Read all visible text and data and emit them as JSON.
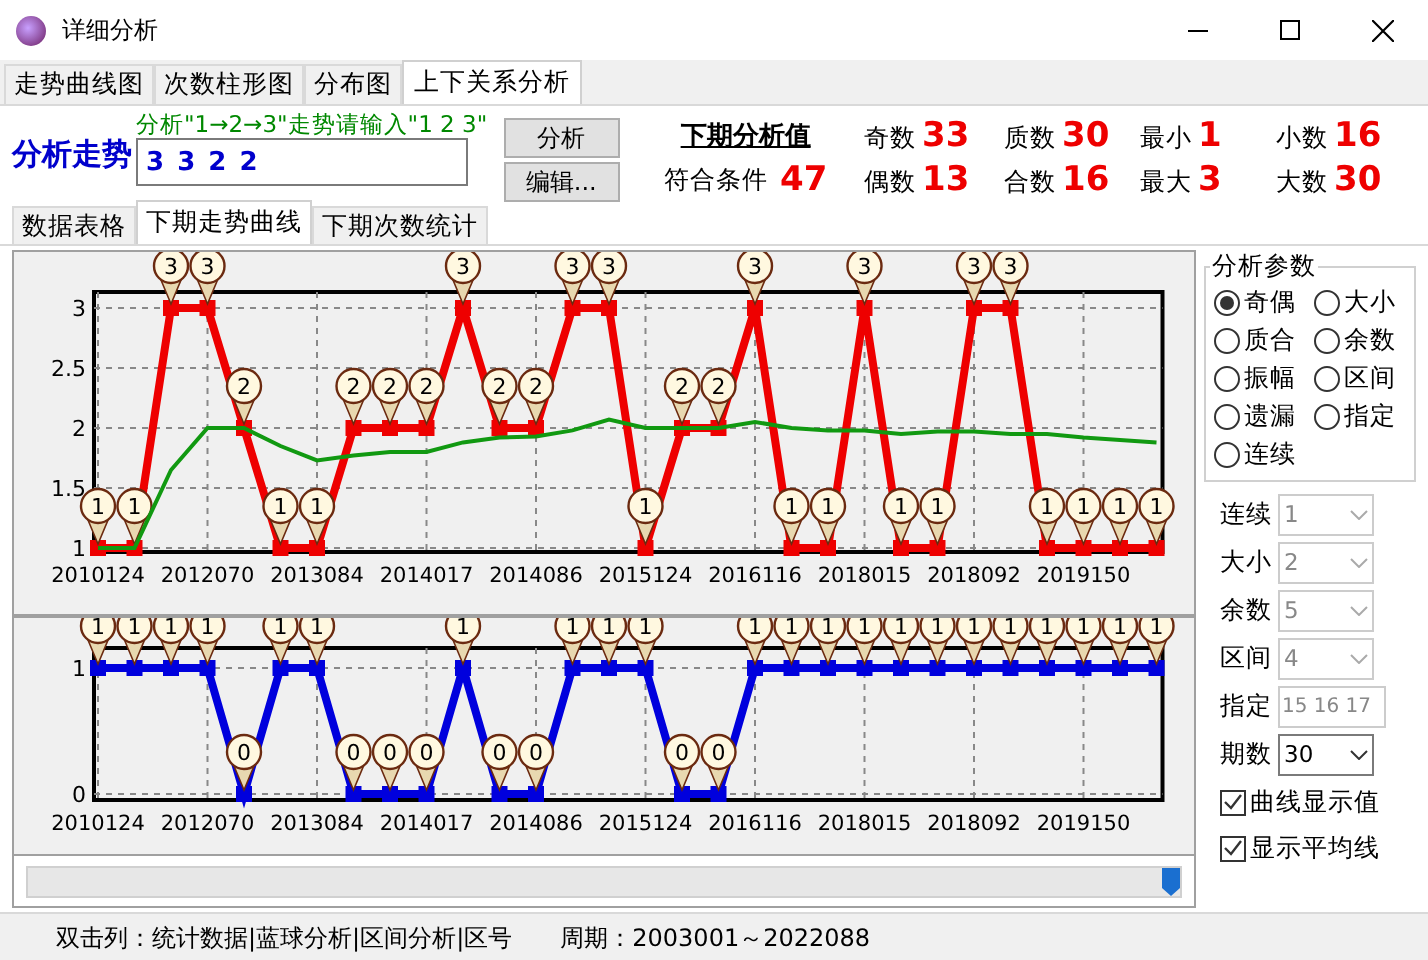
{
  "window": {
    "title": "详细分析"
  },
  "tabs": [
    {
      "label": "走势曲线图",
      "selected": false
    },
    {
      "label": "次数柱形图",
      "selected": false
    },
    {
      "label": "分布图",
      "selected": false
    },
    {
      "label": "上下关系分析",
      "selected": true
    }
  ],
  "analysis": {
    "label": "分析走势",
    "hint": "分析\"1→2→3\"走势请输入\"1 2 3\"",
    "value": "3 3 2 2",
    "buttons": [
      "分析",
      "编辑..."
    ],
    "heading": "下期分析值",
    "match_label": "符合条件",
    "match_value": "47",
    "stats": [
      {
        "label": "奇数",
        "value": "33"
      },
      {
        "label": "质数",
        "value": "30"
      },
      {
        "label": "最小",
        "value": "1"
      },
      {
        "label": "小数",
        "value": "16"
      },
      {
        "label": "偶数",
        "value": "13"
      },
      {
        "label": "合数",
        "value": "16"
      },
      {
        "label": "最大",
        "value": "3"
      },
      {
        "label": "大数",
        "value": "30"
      }
    ]
  },
  "inner_tabs": [
    {
      "label": "数据表格",
      "selected": false
    },
    {
      "label": "下期走势曲线",
      "selected": true
    },
    {
      "label": "下期次数统计",
      "selected": false
    }
  ],
  "charts": [
    {
      "chart_data": {
        "type": "line",
        "categories": [
          "2010124",
          null,
          null,
          "2012070",
          null,
          null,
          "2013084",
          null,
          null,
          "2014017",
          null,
          null,
          "2014086",
          null,
          null,
          "2015124",
          null,
          null,
          "2016116",
          null,
          null,
          "2018015",
          null,
          null,
          "2018092",
          null,
          null,
          "2019150",
          null,
          null
        ],
        "ylim": [
          1,
          3
        ],
        "yticks": [
          1,
          {
            "value": 1.5,
            "label": "1.5"
          },
          2,
          {
            "value": 2.5,
            "label": "2.5"
          },
          3
        ],
        "grid": true,
        "series": [
          {
            "color": "#ee0000",
            "marker": "square",
            "values": [
              1,
              1,
              3,
              3,
              2,
              1,
              1,
              2,
              2,
              2,
              3,
              2,
              2,
              3,
              3,
              1,
              2,
              2,
              3,
              1,
              1,
              3,
              1,
              1,
              3,
              3,
              1,
              1,
              1,
              1
            ],
            "value_labels": [
              "1",
              "1",
              "3",
              "3",
              "2",
              "1",
              "1",
              "2",
              "2",
              "2",
              "3",
              "2",
              "2",
              "3",
              "3",
              "1",
              "2",
              "2",
              "3",
              "1",
              "1",
              "3",
              "1",
              "1",
              "3",
              "3",
              "1",
              "1",
              "1",
              "1"
            ]
          },
          {
            "color": "#119911",
            "values": [
              1,
              1,
              1.65,
              2,
              2,
              1.85,
              1.73,
              1.77,
              1.8,
              1.8,
              1.88,
              1.92,
              1.93,
              1.98,
              2.07,
              2,
              2,
              2,
              2.05,
              2,
              1.98,
              1.98,
              1.95,
              1.97,
              1.97,
              1.95,
              1.95,
              1.92,
              1.9,
              1.88
            ]
          }
        ]
      }
    },
    {
      "chart_data": {
        "type": "line",
        "categories": [
          "2010124",
          null,
          null,
          "2012070",
          null,
          null,
          "2013084",
          null,
          null,
          "2014017",
          null,
          null,
          "2014086",
          null,
          null,
          "2015124",
          null,
          null,
          "2016116",
          null,
          null,
          "2018015",
          null,
          null,
          "2018092",
          null,
          null,
          "2019150",
          null,
          null
        ],
        "ylim": [
          0,
          1
        ],
        "yticks": [
          0,
          1
        ],
        "grid": true,
        "series": [
          {
            "color": "#0000dd",
            "marker": "square",
            "values": [
              1,
              1,
              1,
              1,
              0,
              1,
              1,
              0,
              0,
              0,
              1,
              0,
              0,
              1,
              1,
              1,
              0,
              0,
              1,
              1,
              1,
              1,
              1,
              1,
              1,
              1,
              1,
              1,
              1,
              1
            ],
            "value_labels": [
              "1",
              "1",
              "1",
              "1",
              "0",
              "1",
              "1",
              "0",
              "0",
              "0",
              "1",
              "0",
              "0",
              "1",
              "1",
              "1",
              "0",
              "0",
              "1",
              "1",
              "1",
              "1",
              "1",
              "1",
              "1",
              "1",
              "1",
              "1",
              "1",
              "1"
            ]
          }
        ]
      }
    }
  ],
  "params": {
    "title": "分析参数",
    "options": [
      {
        "label": "奇偶",
        "selected": true
      },
      {
        "label": "大小",
        "selected": false
      },
      {
        "label": "质合",
        "selected": false
      },
      {
        "label": "余数",
        "selected": false
      },
      {
        "label": "振幅",
        "selected": false
      },
      {
        "label": "区间",
        "selected": false
      },
      {
        "label": "遗漏",
        "selected": false
      },
      {
        "label": "指定",
        "selected": false
      },
      {
        "label": "连续",
        "selected": false
      }
    ],
    "fields": [
      {
        "kind": "select",
        "label": "连续",
        "value": "1",
        "disabled": true
      },
      {
        "kind": "select",
        "label": "大小",
        "value": "2",
        "disabled": true
      },
      {
        "kind": "select",
        "label": "余数",
        "value": "5",
        "disabled": true
      },
      {
        "kind": "select",
        "label": "区间",
        "value": "4",
        "disabled": true
      },
      {
        "kind": "text",
        "label": "指定",
        "value": "15 16 17",
        "disabled": true
      },
      {
        "kind": "select",
        "label": "期数",
        "value": "30",
        "disabled": false
      }
    ],
    "checks": [
      {
        "label": "曲线显示值",
        "checked": true
      },
      {
        "label": "显示平均线",
        "checked": true
      }
    ]
  },
  "status_bar": [
    "双击列：统计数据|蓝球分析|区间分析|区号",
    "周期：2003001～2022088"
  ]
}
